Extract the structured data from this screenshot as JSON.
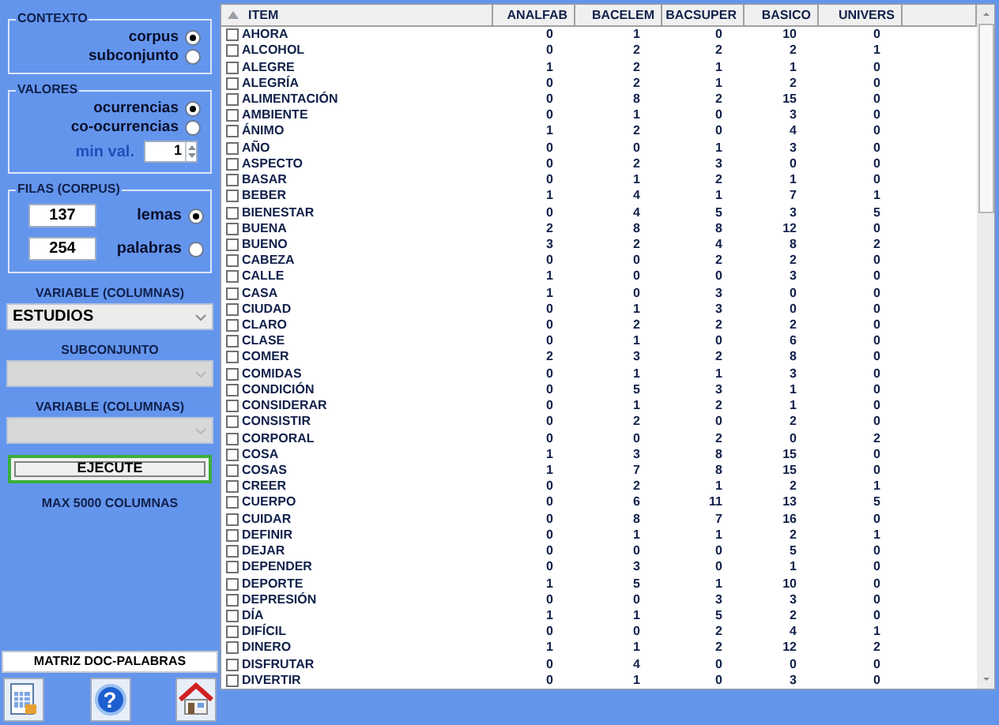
{
  "context": {
    "title": "CONTEXTO",
    "options": [
      {
        "label": "corpus",
        "selected": true
      },
      {
        "label": "subconjunto",
        "selected": false
      }
    ]
  },
  "values": {
    "title": "VALORES",
    "options": [
      {
        "label": "ocurrencias",
        "selected": true
      },
      {
        "label": "co-ocurrencias",
        "selected": false
      }
    ],
    "min_val": {
      "label": "min val.",
      "value": "1"
    }
  },
  "rows_group": {
    "title": "FILAS (CORPUS)",
    "options": [
      {
        "value": "137",
        "label": "lemas",
        "selected": true
      },
      {
        "value": "254",
        "label": "palabras",
        "selected": false
      }
    ]
  },
  "selects": [
    {
      "label": "VARIABLE (COLUMNAS)",
      "value": "ESTUDIOS",
      "disabled": false
    },
    {
      "label": "SUBCONJUNTO",
      "disabled": true
    },
    {
      "label": "VARIABLE (COLUMNAS)",
      "disabled": true
    }
  ],
  "execute_button": "EJECUTE",
  "max_note": "MAX 5000 COLUMNAS",
  "matrix_button": "MATRIZ DOC-PALABRAS",
  "help_symbol": "?",
  "table": {
    "columns": [
      "ITEM",
      "ANALFAB",
      "BACELEM",
      "BACSUPER",
      "BASICO",
      "UNIVERS"
    ],
    "rows": [
      {
        "item": "AHORA",
        "checked": false,
        "values": [
          "0",
          "1",
          "0",
          "10",
          "0"
        ]
      },
      {
        "item": "ALCOHOL",
        "checked": false,
        "values": [
          "0",
          "2",
          "2",
          "2",
          "1"
        ]
      },
      {
        "item": "ALEGRE",
        "checked": false,
        "values": [
          "1",
          "2",
          "1",
          "1",
          "0"
        ]
      },
      {
        "item": "ALEGRÍA",
        "checked": false,
        "values": [
          "0",
          "2",
          "1",
          "2",
          "0"
        ]
      },
      {
        "item": "ALIMENTACIÓN",
        "checked": false,
        "values": [
          "0",
          "8",
          "2",
          "15",
          "0"
        ]
      },
      {
        "item": "AMBIENTE",
        "checked": false,
        "values": [
          "0",
          "1",
          "0",
          "3",
          "0"
        ]
      },
      {
        "item": "ÁNIMO",
        "checked": false,
        "values": [
          "1",
          "2",
          "0",
          "4",
          "0"
        ]
      },
      {
        "item": "AÑO",
        "checked": false,
        "values": [
          "0",
          "0",
          "1",
          "3",
          "0"
        ]
      },
      {
        "item": "ASPECTO",
        "checked": false,
        "values": [
          "0",
          "2",
          "3",
          "0",
          "0"
        ]
      },
      {
        "item": "BASAR",
        "checked": false,
        "values": [
          "0",
          "1",
          "2",
          "1",
          "0"
        ]
      },
      {
        "item": "BEBER",
        "checked": false,
        "values": [
          "1",
          "4",
          "1",
          "7",
          "1"
        ]
      },
      {
        "item": "BIENESTAR",
        "checked": false,
        "values": [
          "0",
          "4",
          "5",
          "3",
          "5"
        ]
      },
      {
        "item": "BUENA",
        "checked": false,
        "values": [
          "2",
          "8",
          "8",
          "12",
          "0"
        ]
      },
      {
        "item": "BUENO",
        "checked": false,
        "values": [
          "3",
          "2",
          "4",
          "8",
          "2"
        ]
      },
      {
        "item": "CABEZA",
        "checked": false,
        "values": [
          "0",
          "0",
          "2",
          "2",
          "0"
        ]
      },
      {
        "item": "CALLE",
        "checked": false,
        "values": [
          "1",
          "0",
          "0",
          "3",
          "0"
        ]
      },
      {
        "item": "CASA",
        "checked": false,
        "values": [
          "1",
          "0",
          "3",
          "0",
          "0"
        ]
      },
      {
        "item": "CIUDAD",
        "checked": false,
        "values": [
          "0",
          "1",
          "3",
          "0",
          "0"
        ]
      },
      {
        "item": "CLARO",
        "checked": false,
        "values": [
          "0",
          "2",
          "2",
          "2",
          "0"
        ]
      },
      {
        "item": "CLASE",
        "checked": false,
        "values": [
          "0",
          "1",
          "0",
          "6",
          "0"
        ]
      },
      {
        "item": "COMER",
        "checked": false,
        "values": [
          "2",
          "3",
          "2",
          "8",
          "0"
        ]
      },
      {
        "item": "COMIDAS",
        "checked": false,
        "values": [
          "0",
          "1",
          "1",
          "3",
          "0"
        ]
      },
      {
        "item": "CONDICIÓN",
        "checked": false,
        "values": [
          "0",
          "5",
          "3",
          "1",
          "0"
        ]
      },
      {
        "item": "CONSIDERAR",
        "checked": false,
        "values": [
          "0",
          "1",
          "2",
          "1",
          "0"
        ]
      },
      {
        "item": "CONSISTIR",
        "checked": false,
        "values": [
          "0",
          "2",
          "0",
          "2",
          "0"
        ]
      },
      {
        "item": "CORPORAL",
        "checked": false,
        "values": [
          "0",
          "0",
          "2",
          "0",
          "2"
        ]
      },
      {
        "item": "COSA",
        "checked": false,
        "values": [
          "1",
          "3",
          "8",
          "15",
          "0"
        ]
      },
      {
        "item": "COSAS",
        "checked": false,
        "values": [
          "1",
          "7",
          "8",
          "15",
          "0"
        ]
      },
      {
        "item": "CREER",
        "checked": false,
        "values": [
          "0",
          "2",
          "1",
          "2",
          "1"
        ]
      },
      {
        "item": "CUERPO",
        "checked": false,
        "values": [
          "0",
          "6",
          "11",
          "13",
          "5"
        ]
      },
      {
        "item": "CUIDAR",
        "checked": false,
        "values": [
          "0",
          "8",
          "7",
          "16",
          "0"
        ]
      },
      {
        "item": "DEFINIR",
        "checked": false,
        "values": [
          "0",
          "1",
          "1",
          "2",
          "1"
        ]
      },
      {
        "item": "DEJAR",
        "checked": false,
        "values": [
          "0",
          "0",
          "0",
          "5",
          "0"
        ]
      },
      {
        "item": "DEPENDER",
        "checked": false,
        "values": [
          "0",
          "3",
          "0",
          "1",
          "0"
        ]
      },
      {
        "item": "DEPORTE",
        "checked": false,
        "values": [
          "1",
          "5",
          "1",
          "10",
          "0"
        ]
      },
      {
        "item": "DEPRESIÓN",
        "checked": false,
        "values": [
          "0",
          "0",
          "3",
          "3",
          "0"
        ]
      },
      {
        "item": "DÍA",
        "checked": false,
        "values": [
          "1",
          "1",
          "5",
          "2",
          "0"
        ]
      },
      {
        "item": "DIFÍCIL",
        "checked": false,
        "values": [
          "0",
          "0",
          "2",
          "4",
          "1"
        ]
      },
      {
        "item": "DINERO",
        "checked": false,
        "values": [
          "1",
          "1",
          "2",
          "12",
          "2"
        ]
      },
      {
        "item": "DISFRUTAR",
        "checked": false,
        "values": [
          "0",
          "4",
          "0",
          "0",
          "0"
        ]
      },
      {
        "item": "DIVERTIR",
        "checked": false,
        "values": [
          "0",
          "1",
          "0",
          "3",
          "0"
        ]
      }
    ]
  }
}
